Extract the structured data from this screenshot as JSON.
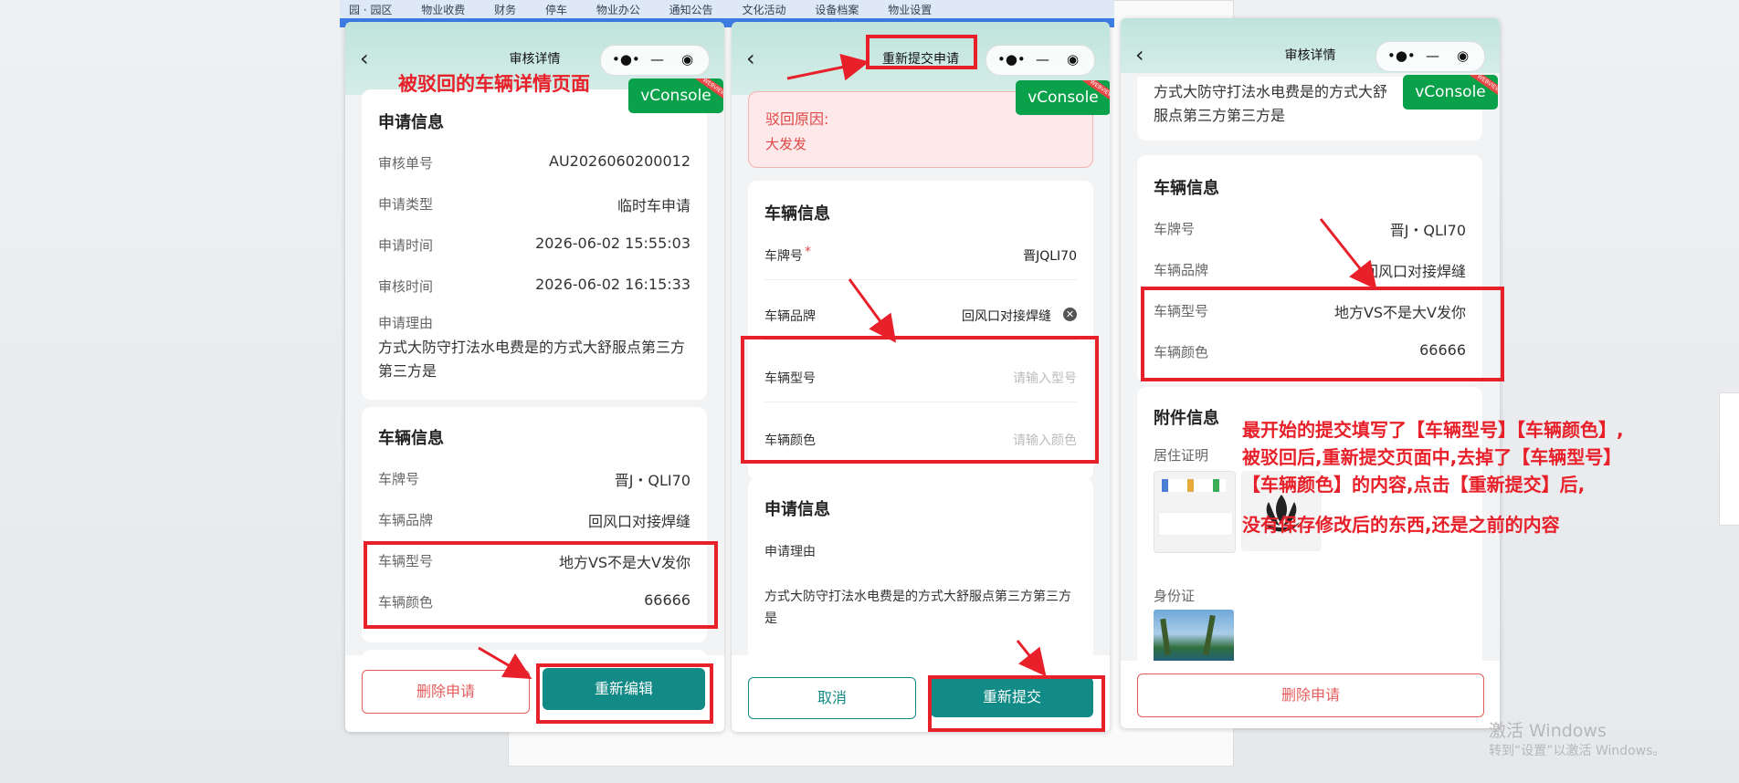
{
  "taskbar": [
    "园 · 园区",
    "物业收费",
    "财务",
    "停车",
    "物业办公",
    "通知公告",
    "文化活动",
    "设备档案",
    "物业设置"
  ],
  "capsule": {
    "more": "•●•",
    "minus": "—",
    "record": "◉"
  },
  "vconsole": {
    "label": "vConsole",
    "ribbon": "WEBVIEW"
  },
  "panel1": {
    "title": "审核详情",
    "back": "‹",
    "annotation": "被驳回的车辆详情页面",
    "apply": {
      "section": "申请信息",
      "rows": [
        {
          "label": "审核单号",
          "value": "AU2026060200012"
        },
        {
          "label": "申请类型",
          "value": "临时车申请"
        },
        {
          "label": "申请时间",
          "value": "2026-06-02 15:55:03"
        },
        {
          "label": "审核时间",
          "value": "2026-06-02 16:15:33"
        }
      ],
      "reason_label": "申请理由",
      "reason_text": "方式大防守打法水电费是的方式大舒服点第三方第三方是"
    },
    "vehicle": {
      "section": "车辆信息",
      "rows": [
        {
          "label": "车牌号",
          "value": "晋J・QLI70"
        },
        {
          "label": "车辆品牌",
          "value": "回风口对接焊缝"
        },
        {
          "label": "车辆型号",
          "value": "地方VS不是大V发你"
        },
        {
          "label": "车辆颜色",
          "value": "66666"
        }
      ]
    },
    "buttons": {
      "delete": "删除申请",
      "reedit": "重新编辑"
    }
  },
  "panel2": {
    "title": "重新提交申请",
    "back": "‹",
    "reject": {
      "label": "驳回原因:",
      "text": "大发发"
    },
    "vehicle": {
      "section": "车辆信息",
      "plate_label": "车牌号",
      "required_mark": "*",
      "plate_value": "晋JQLI70",
      "brand_label": "车辆品牌",
      "brand_value": "回风口对接焊缝",
      "model_label": "车辆型号",
      "model_placeholder": "请输入型号",
      "color_label": "车辆颜色",
      "color_placeholder": "请输入颜色"
    },
    "apply": {
      "section": "申请信息",
      "reason_label": "申请理由",
      "reason_text": "方式大防守打法水电费是的方式大舒服点第三方第三方是"
    },
    "buttons": {
      "cancel": "取消",
      "resubmit": "重新提交"
    }
  },
  "panel3": {
    "title": "审核详情",
    "back": "‹",
    "reason_text": "方式大防守打法水电费是的方式大舒服点第三方第三方是",
    "vehicle": {
      "section": "车辆信息",
      "rows": [
        {
          "label": "车牌号",
          "value": "晋J・QLI70"
        },
        {
          "label": "车辆品牌",
          "value": "回风口对接焊缝"
        },
        {
          "label": "车辆型号",
          "value": "地方VS不是大V发你"
        },
        {
          "label": "车辆颜色",
          "value": "66666"
        }
      ]
    },
    "attach": {
      "section": "附件信息",
      "residence": "居住证明",
      "idcard": "身份证"
    },
    "buttons": {
      "delete": "删除申请"
    }
  },
  "annotations": {
    "line1": "最开始的提交填写了【车辆型号】【车辆颜色】,",
    "line2": "被驳回后,重新提交页面中,去掉了【车辆型号】",
    "line3": "【车辆颜色】的内容,点击【重新提交】后,",
    "line4": "没有保存修改后的东西,还是之前的内容"
  },
  "windows_watermark": {
    "title": "激活 Windows",
    "sub": "转到“设置”以激活 Windows。"
  },
  "colors": {
    "teal": "#128a86",
    "annotation_red": "#e8202a",
    "vconsole_green": "#0aa14b",
    "reject_bg": "#fde9e9"
  }
}
